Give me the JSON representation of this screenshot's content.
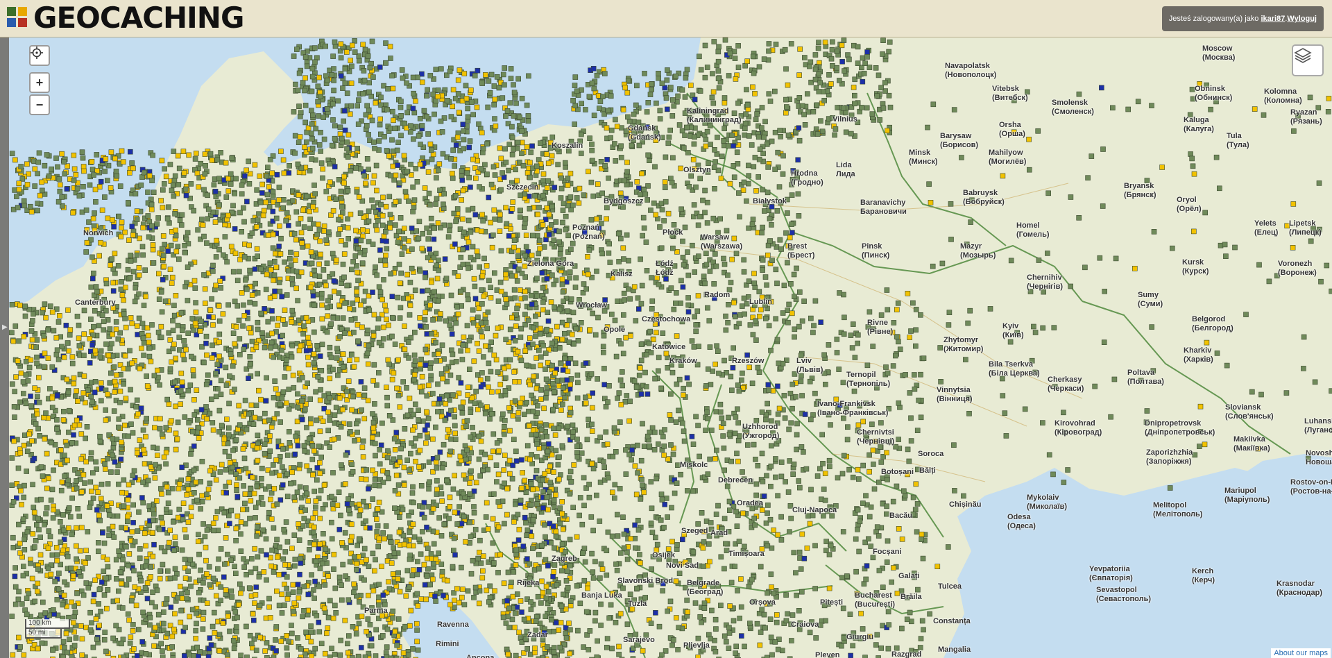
{
  "header": {
    "logo_text": "GEOCACHING",
    "logged_in_prefix": "Jesteś zalogowany(a) jako",
    "username": "ikari87",
    "separator": ". ",
    "logout_label": "Wyloguj"
  },
  "controls": {
    "locate_icon": "crosshair-icon",
    "zoom_in": "+",
    "zoom_out": "−",
    "layers_icon": "layers-icon"
  },
  "scale": {
    "km": "100 km",
    "mi": "50 mi"
  },
  "footer": {
    "about": "About our maps"
  },
  "colors": {
    "land": "#e8ebd4",
    "water": "#c4ddf0",
    "border": "#4f8a3c",
    "cache_traditional": "#6f8a5a",
    "cache_yellow": "#f2c200",
    "cache_blue": "#1c2fa8"
  },
  "cities": [
    {
      "name": "Kaliningrad",
      "native": "(Калининград)"
    },
    {
      "name": "Gdańsk",
      "native": "(Gdańsk)"
    },
    {
      "name": "Koszalin",
      "native": ""
    },
    {
      "name": "Szczecin",
      "native": ""
    },
    {
      "name": "Olsztyn",
      "native": ""
    },
    {
      "name": "Bydgoszcz",
      "native": ""
    },
    {
      "name": "Białystok",
      "native": ""
    },
    {
      "name": "Poznań",
      "native": "(Poznań)"
    },
    {
      "name": "Płock",
      "native": ""
    },
    {
      "name": "Warsaw",
      "native": "(Warszawa)"
    },
    {
      "name": "Łódź",
      "native": "Łódź"
    },
    {
      "name": "Kalisz",
      "native": ""
    },
    {
      "name": "Zielona Góra",
      "native": ""
    },
    {
      "name": "Wrocław",
      "native": ""
    },
    {
      "name": "Radom",
      "native": ""
    },
    {
      "name": "Lublin",
      "native": ""
    },
    {
      "name": "Opole",
      "native": ""
    },
    {
      "name": "Częstochowa",
      "native": ""
    },
    {
      "name": "Katowice",
      "native": ""
    },
    {
      "name": "Kraków",
      "native": ""
    },
    {
      "name": "Rzeszów",
      "native": ""
    },
    {
      "name": "Brest",
      "native": "(Брест)"
    },
    {
      "name": "Vilnius",
      "native": ""
    },
    {
      "name": "Lida",
      "native": "Лида"
    },
    {
      "name": "Hrodna",
      "native": "(Гродно)"
    },
    {
      "name": "Baranavichy",
      "native": "Барановичи"
    },
    {
      "name": "Minsk",
      "native": "(Минск)"
    },
    {
      "name": "Barysaw",
      "native": "(Борисов)"
    },
    {
      "name": "Orsha",
      "native": "(Орша)"
    },
    {
      "name": "Vitebsk",
      "native": "(Витебск)"
    },
    {
      "name": "Navapolatsk",
      "native": "(Новополоцк)"
    },
    {
      "name": "Mahilyow",
      "native": "(Могилёв)"
    },
    {
      "name": "Babruysk",
      "native": "(Бобруйск)"
    },
    {
      "name": "Pinsk",
      "native": "(Пинск)"
    },
    {
      "name": "Mazyr",
      "native": "(Мозырь)"
    },
    {
      "name": "Homel",
      "native": "(Гомель)"
    },
    {
      "name": "Smolensk",
      "native": "(Смоленск)"
    },
    {
      "name": "Moscow",
      "native": "(Москва)"
    },
    {
      "name": "Obninsk",
      "native": "(Обнинск)"
    },
    {
      "name": "Kolomna",
      "native": "(Коломна)"
    },
    {
      "name": "Kaluga",
      "native": "(Калуга)"
    },
    {
      "name": "Tula",
      "native": "(Тула)"
    },
    {
      "name": "Ryazan",
      "native": "(Рязань)"
    },
    {
      "name": "Bryansk",
      "native": "(Брянск)"
    },
    {
      "name": "Oryol",
      "native": "(Орёл)"
    },
    {
      "name": "Yelets",
      "native": "(Елец)"
    },
    {
      "name": "Lipetsk",
      "native": "(Липецк)"
    },
    {
      "name": "Kursk",
      "native": "(Курск)"
    },
    {
      "name": "Voronezh",
      "native": "(Воронеж)"
    },
    {
      "name": "Belgorod",
      "native": "(Белгород)"
    },
    {
      "name": "Kharkiv",
      "native": "(Харків)"
    },
    {
      "name": "Sumy",
      "native": "(Суми)"
    },
    {
      "name": "Chernihiv",
      "native": "(Чернігів)"
    },
    {
      "name": "Kyiv",
      "native": "(Київ)"
    },
    {
      "name": "Zhytomyr",
      "native": "(Житомир)"
    },
    {
      "name": "Rivne",
      "native": "(Рівне)"
    },
    {
      "name": "Lviv",
      "native": "(Львів)"
    },
    {
      "name": "Ternopil",
      "native": "(Тернопіль)"
    },
    {
      "name": "Ivano-Frankivsk",
      "native": "(Івано-Франківськ)"
    },
    {
      "name": "Chernivtsi",
      "native": "(Чернівці)"
    },
    {
      "name": "Vinnytsia",
      "native": "(Вінниця)"
    },
    {
      "name": "Bila Tserkva",
      "native": "(Біла Церква)"
    },
    {
      "name": "Cherkasy",
      "native": "(Черкаси)"
    },
    {
      "name": "Poltava",
      "native": "(Полтава)"
    },
    {
      "name": "Kirovohrad",
      "native": "(Кіровоград)"
    },
    {
      "name": "Dnipropetrovsk",
      "native": "(Дніпропетровськ)"
    },
    {
      "name": "Zaporizhzhia",
      "native": "(Запоріжжя)"
    },
    {
      "name": "Sloviansk",
      "native": "(Слов'янськ)"
    },
    {
      "name": "Luhansk",
      "native": "(Луганськ)"
    },
    {
      "name": "Makiivka",
      "native": "(Макіївка)"
    },
    {
      "name": "Novoshakhtinsk",
      "native": "Новошахт"
    },
    {
      "name": "Rostov-on-Don",
      "native": "(Ростов-на-"
    },
    {
      "name": "Mariupol",
      "native": "(Маріуполь)"
    },
    {
      "name": "Melitopol",
      "native": "(Мелітополь)"
    },
    {
      "name": "Mykolaiv",
      "native": "(Миколаїв)"
    },
    {
      "name": "Odesa",
      "native": "(Одеса)"
    },
    {
      "name": "Chișinău",
      "native": ""
    },
    {
      "name": "Bălți",
      "native": ""
    },
    {
      "name": "Botoșani",
      "native": ""
    },
    {
      "name": "Soroca",
      "native": ""
    },
    {
      "name": "Kerch",
      "native": "(Керч)"
    },
    {
      "name": "Krasnodar",
      "native": "(Краснодар)"
    },
    {
      "name": "Yevpatoriia",
      "native": "(Євпаторія)"
    },
    {
      "name": "Sevastopol",
      "native": "(Севастополь)"
    },
    {
      "name": "Galați",
      "native": ""
    },
    {
      "name": "Focșani",
      "native": ""
    },
    {
      "name": "Bacău",
      "native": ""
    },
    {
      "name": "Bucharest",
      "native": "(București)"
    },
    {
      "name": "Constanța",
      "native": ""
    },
    {
      "name": "Tulcea",
      "native": ""
    },
    {
      "name": "Brăila",
      "native": ""
    },
    {
      "name": "Cluj-Napoca",
      "native": ""
    },
    {
      "name": "Oradea",
      "native": ""
    },
    {
      "name": "Debrecen",
      "native": ""
    },
    {
      "name": "Miskolc",
      "native": ""
    },
    {
      "name": "Uzhhorod",
      "native": "(Ужгород)"
    },
    {
      "name": "Timișoara",
      "native": ""
    },
    {
      "name": "Arad",
      "native": ""
    },
    {
      "name": "Szeged",
      "native": ""
    },
    {
      "name": "Belgrade",
      "native": "(Београд)"
    },
    {
      "name": "Novi Sad",
      "native": ""
    },
    {
      "name": "Orșova",
      "native": ""
    },
    {
      "name": "Craiova",
      "native": ""
    },
    {
      "name": "Pitești",
      "native": ""
    },
    {
      "name": "Zagreb",
      "native": ""
    },
    {
      "name": "Rijeka",
      "native": ""
    },
    {
      "name": "Banja Luka",
      "native": ""
    },
    {
      "name": "Tuzla",
      "native": ""
    },
    {
      "name": "Sarajevo",
      "native": ""
    },
    {
      "name": "Pljevlja",
      "native": ""
    },
    {
      "name": "Razgrad",
      "native": ""
    },
    {
      "name": "Pleven",
      "native": ""
    },
    {
      "name": "Giurgiu",
      "native": ""
    },
    {
      "name": "Mangalia",
      "native": ""
    },
    {
      "name": "Rimini",
      "native": ""
    },
    {
      "name": "Ancona",
      "native": ""
    },
    {
      "name": "Ravenna",
      "native": ""
    },
    {
      "name": "Parma",
      "native": ""
    },
    {
      "name": "Canterbury",
      "native": ""
    },
    {
      "name": "Norwich",
      "native": ""
    },
    {
      "name": "Slavonski Brod",
      "native": ""
    },
    {
      "name": "Osijek",
      "native": ""
    },
    {
      "name": "Zadar",
      "native": ""
    }
  ]
}
